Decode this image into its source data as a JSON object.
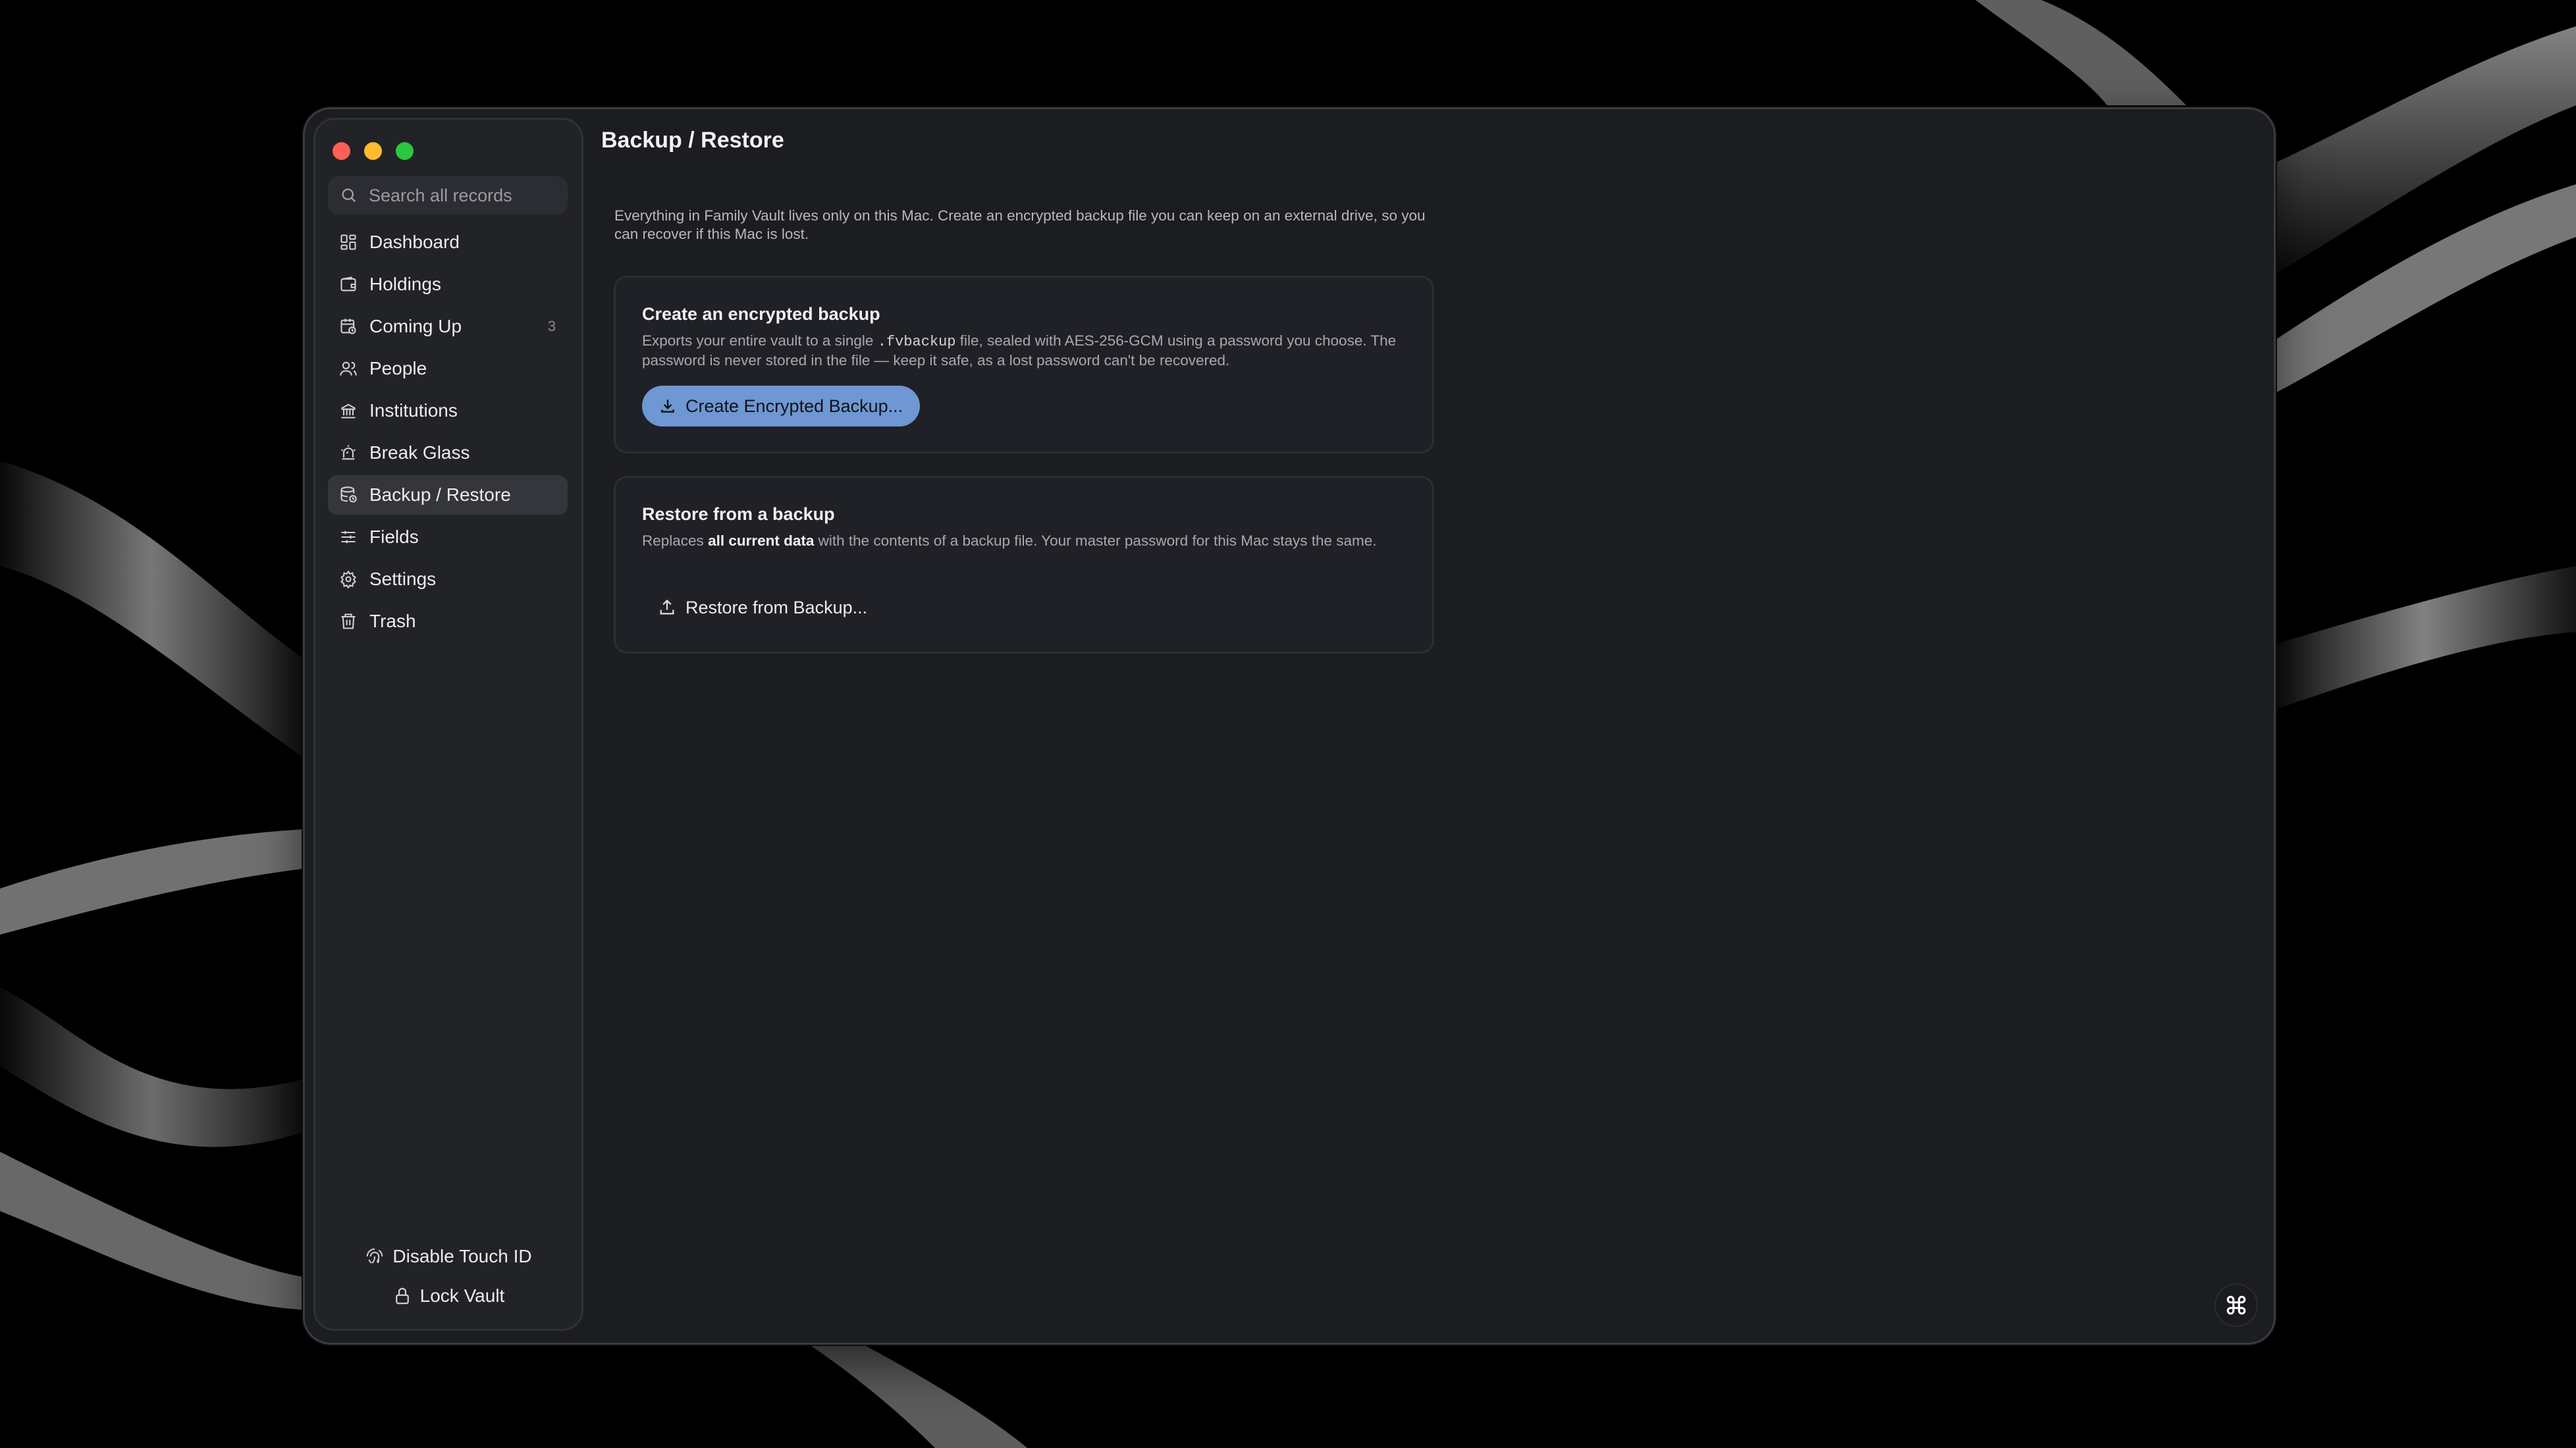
{
  "window": {
    "page_title": "Backup / Restore"
  },
  "search": {
    "placeholder": "Search all records"
  },
  "sidebar": {
    "items": [
      {
        "label": "Dashboard",
        "icon": "dashboard-icon"
      },
      {
        "label": "Holdings",
        "icon": "wallet-icon"
      },
      {
        "label": "Coming Up",
        "icon": "calendar-icon",
        "badge": "3"
      },
      {
        "label": "People",
        "icon": "people-icon"
      },
      {
        "label": "Institutions",
        "icon": "bank-icon"
      },
      {
        "label": "Break Glass",
        "icon": "siren-icon"
      },
      {
        "label": "Backup / Restore",
        "icon": "database-icon",
        "active": true
      },
      {
        "label": "Fields",
        "icon": "sliders-icon"
      },
      {
        "label": "Settings",
        "icon": "gear-icon"
      },
      {
        "label": "Trash",
        "icon": "trash-icon"
      }
    ],
    "footer": {
      "disable_touch_id": "Disable Touch ID",
      "lock_vault": "Lock Vault"
    }
  },
  "main": {
    "intro": "Everything in Family Vault lives only on this Mac. Create an encrypted backup file you can keep on an external drive, so you can recover if this Mac is lost.",
    "backup_card": {
      "title": "Create an encrypted backup",
      "desc_before": "Exports your entire vault to a single ",
      "desc_code": ".fvbackup",
      "desc_after": " file, sealed with AES-256-GCM using a password you choose. The password is never stored in the file — keep it safe, as a lost password can't be recovered.",
      "button": "Create Encrypted Backup..."
    },
    "restore_card": {
      "title": "Restore from a backup",
      "desc_before": "Replaces ",
      "desc_bold": "all current data",
      "desc_after": " with the contents of a backup file. Your master password for this Mac stays the same.",
      "button": "Restore from Backup..."
    }
  },
  "colors": {
    "accent_button": "#6e97d3",
    "window_bg": "#1c1d21",
    "sidebar_bg": "#222327"
  }
}
